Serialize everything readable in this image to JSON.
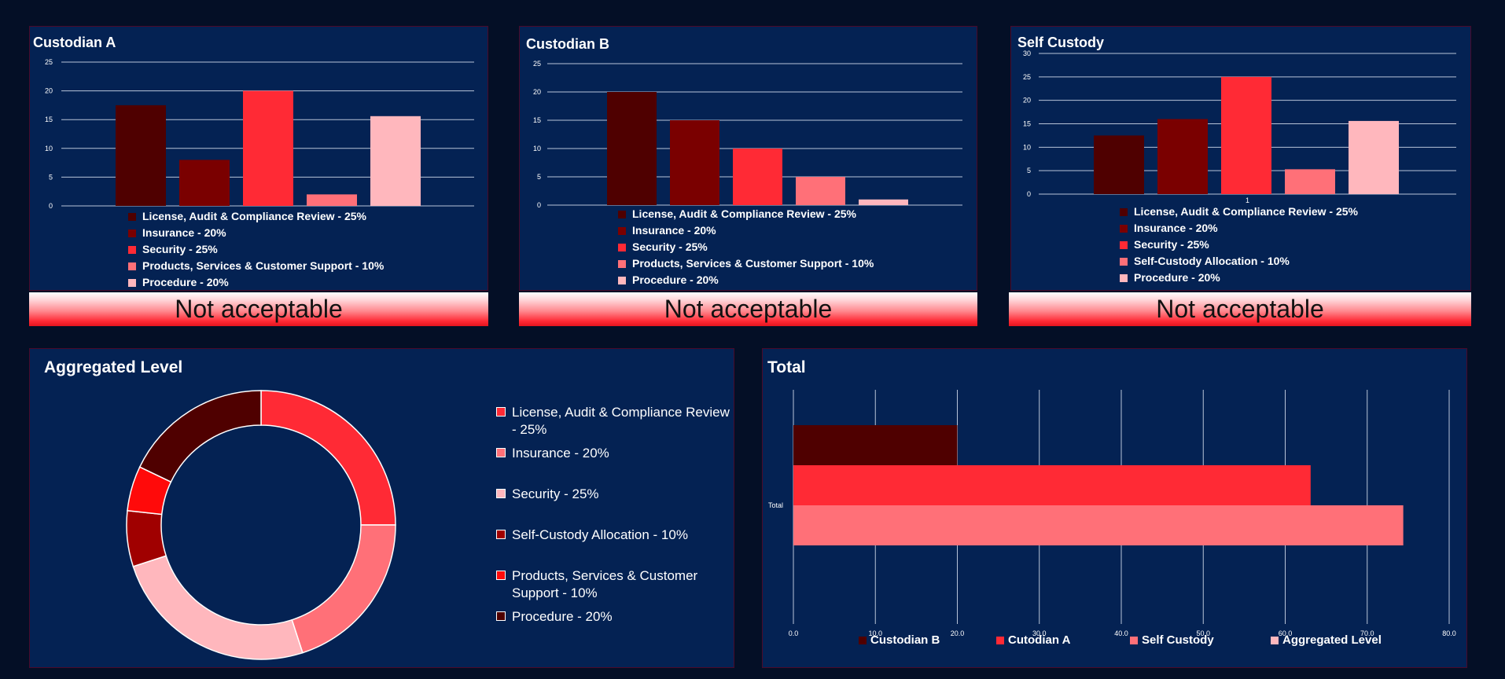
{
  "colors": {
    "license": "#4f0000",
    "insurance": "#7a0000",
    "security": "#ff2a35",
    "products": "#ff7078",
    "procedure": "#ffb7bd",
    "selfcustody_alloc": "#ff0a0a"
  },
  "custodian_a": {
    "title": "Custodian A",
    "status": "Not acceptable",
    "legend": [
      {
        "label": "License, Audit & Compliance Review - 25%",
        "color": "#4f0000"
      },
      {
        "label": "Insurance - 20%",
        "color": "#7a0000"
      },
      {
        "label": "Security - 25%",
        "color": "#ff2a35"
      },
      {
        "label": "Products, Services & Customer Support - 10%",
        "color": "#ff7078"
      },
      {
        "label": "Procedure - 20%",
        "color": "#ffb7bd"
      }
    ]
  },
  "custodian_b": {
    "title": "Custodian B",
    "status": "Not acceptable",
    "legend": [
      {
        "label": "License, Audit & Compliance Review - 25%",
        "color": "#4f0000"
      },
      {
        "label": "Insurance - 20%",
        "color": "#7a0000"
      },
      {
        "label": "Security - 25%",
        "color": "#ff2a35"
      },
      {
        "label": "Products, Services & Customer Support - 10%",
        "color": "#ff7078"
      },
      {
        "label": "Procedure - 20%",
        "color": "#ffb7bd"
      }
    ]
  },
  "self_custody": {
    "title": "Self Custody",
    "status": "Not acceptable",
    "legend": [
      {
        "label": "License, Audit & Compliance Review - 25%",
        "color": "#4f0000"
      },
      {
        "label": "Insurance - 20%",
        "color": "#7a0000"
      },
      {
        "label": "Security - 25%",
        "color": "#ff2a35"
      },
      {
        "label": "Self-Custody Allocation - 10%",
        "color": "#ff7078"
      },
      {
        "label": "Procedure - 20%",
        "color": "#ffb7bd"
      }
    ]
  },
  "aggregated": {
    "title": "Aggregated Level",
    "legend": [
      {
        "label": "License, Audit & Compliance Review - 25%",
        "color": "#ff2a35"
      },
      {
        "label": "Insurance - 20%",
        "color": "#ff7078"
      },
      {
        "label": "Security - 25%",
        "color": "#ffb7bd"
      },
      {
        "label": "Self-Custody Allocation - 10%",
        "color": "#a00000"
      },
      {
        "label": "Products, Services & Customer Support - 10%",
        "color": "#ff0a0a"
      },
      {
        "label": "Procedure - 20%",
        "color": "#4f0000"
      }
    ]
  },
  "total": {
    "title": "Total",
    "legend": [
      {
        "label": "Custodian B",
        "color": "#4f0000"
      },
      {
        "label": "Cutodian A",
        "color": "#ff2a35"
      },
      {
        "label": "Self  Custody",
        "color": "#ff7078"
      },
      {
        "label": "Aggregated Level",
        "color": "#ffb7bd"
      }
    ]
  },
  "chart_data": [
    {
      "id": "custodian_a",
      "type": "bar",
      "title": "Custodian A",
      "categories": [
        "License, Audit & Compliance Review - 25%",
        "Insurance - 20%",
        "Security - 25%",
        "Products, Services & Customer Support - 10%",
        "Procedure - 20%"
      ],
      "values": [
        17.5,
        8,
        20,
        2,
        15.6
      ],
      "colors": [
        "#4f0000",
        "#7a0000",
        "#ff2a35",
        "#ff7078",
        "#ffb7bd"
      ],
      "ylim": [
        0,
        25
      ],
      "yticks": [
        0,
        5,
        10,
        15,
        20,
        25
      ],
      "xticks": [],
      "grid": true,
      "legend_position": "bottom"
    },
    {
      "id": "custodian_b",
      "type": "bar",
      "title": "Custodian B",
      "categories": [
        "License, Audit & Compliance Review - 25%",
        "Insurance - 20%",
        "Security - 25%",
        "Products, Services & Customer Support - 10%",
        "Procedure - 20%"
      ],
      "values": [
        20,
        15,
        10,
        5,
        1
      ],
      "colors": [
        "#4f0000",
        "#7a0000",
        "#ff2a35",
        "#ff7078",
        "#ffb7bd"
      ],
      "ylim": [
        0,
        25
      ],
      "yticks": [
        0,
        5,
        10,
        15,
        20,
        25
      ],
      "xticks": [],
      "grid": true,
      "legend_position": "bottom"
    },
    {
      "id": "self_custody",
      "type": "bar",
      "title": "Self Custody",
      "categories": [
        "License, Audit & Compliance Review - 25%",
        "Insurance - 20%",
        "Security - 25%",
        "Self-Custody Allocation - 10%",
        "Procedure - 20%"
      ],
      "values": [
        12.5,
        16,
        25,
        5.3,
        15.6
      ],
      "colors": [
        "#4f0000",
        "#7a0000",
        "#ff2a35",
        "#ff7078",
        "#ffb7bd"
      ],
      "ylim": [
        0,
        30
      ],
      "yticks": [
        0,
        5,
        10,
        15,
        20,
        25,
        30
      ],
      "xticks": [
        "1"
      ],
      "grid": true,
      "legend_position": "bottom"
    },
    {
      "id": "aggregated",
      "type": "pie",
      "title": "Aggregated Level",
      "donut": true,
      "labels": [
        "License, Audit & Compliance Review - 25%",
        "Insurance - 20%",
        "Procedure - 20%",
        "Self-Custody Allocation - 10%",
        "Products, Services & Customer Support - 10%",
        "Procedure - 20%"
      ],
      "values": [
        25,
        20,
        25,
        6.7,
        5.4,
        17.9
      ],
      "colors": [
        "#ff2a35",
        "#ff7078",
        "#ffb7bd",
        "#a00000",
        "#ff0a0a",
        "#4f0000"
      ],
      "legend_position": "right"
    },
    {
      "id": "total",
      "type": "bar",
      "orientation": "horizontal",
      "title": "Total",
      "categories": [
        "Total"
      ],
      "series": [
        {
          "name": "Custodian B",
          "values": [
            20
          ],
          "color": "#4f0000"
        },
        {
          "name": "Cutodian A",
          "values": [
            63.1
          ],
          "color": "#ff2a35"
        },
        {
          "name": "Self  Custody",
          "values": [
            74.4
          ],
          "color": "#ff7078"
        }
      ],
      "xlim": [
        0,
        80
      ],
      "xticks": [
        "0.0",
        "10.0",
        "20.0",
        "30.0",
        "40.0",
        "50.0",
        "60.0",
        "70.0",
        "80.0"
      ],
      "grid": true,
      "legend_position": "bottom"
    }
  ]
}
